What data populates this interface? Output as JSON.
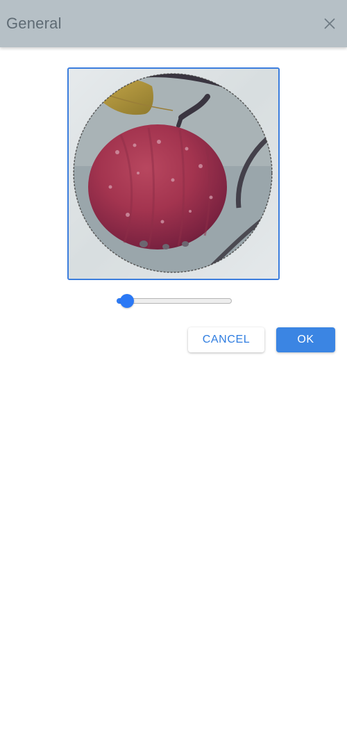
{
  "dialog": {
    "title": "General"
  },
  "icons": {
    "close": "close-icon"
  },
  "cropper": {
    "image": "red-apple-with-water-drops",
    "crop_shape": "circle",
    "frame_color": "#3b7ddd"
  },
  "zoom_slider": {
    "value": 0.04,
    "accent_color": "#2a78f5"
  },
  "buttons": {
    "cancel_label": "CANCEL",
    "ok_label": "OK"
  },
  "colors": {
    "header_bg": "#b6c0c6",
    "title": "#5f6b74",
    "primary": "#3b85e3"
  }
}
